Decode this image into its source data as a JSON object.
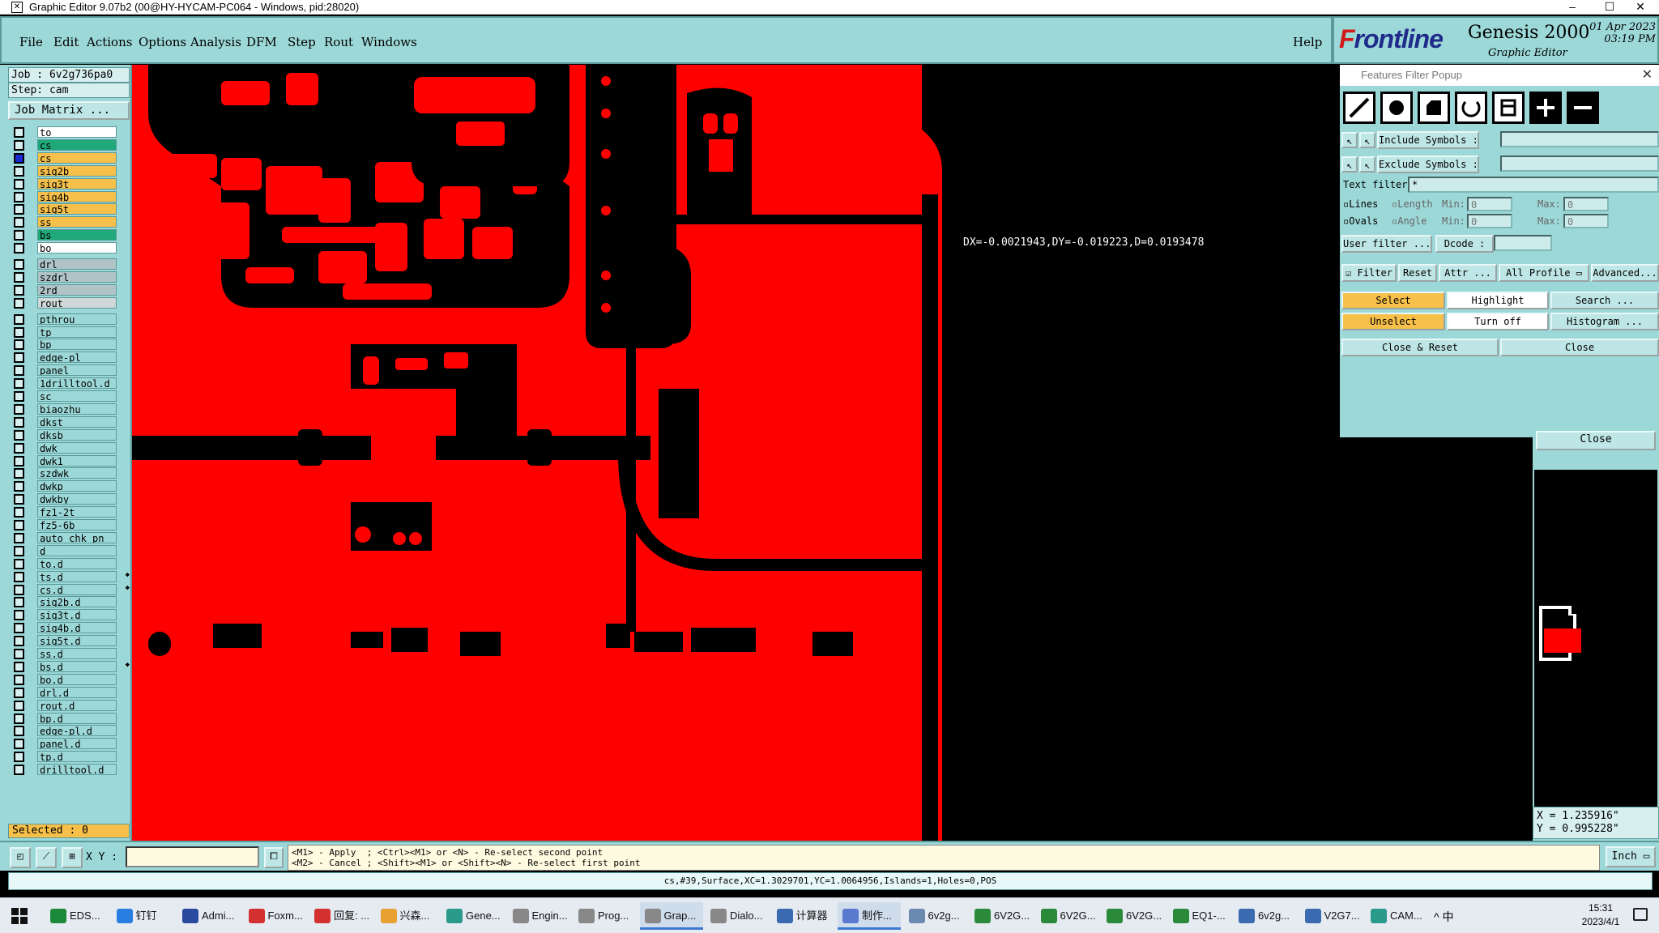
{
  "window": {
    "title": "Graphic Editor 9.07b2 (00@HY-HYCAM-PC064 - Windows, pid:28020)",
    "minimize": "–",
    "maximize": "☐",
    "close": "✕"
  },
  "menu": [
    "File",
    "Edit",
    "Actions",
    "Options",
    "Analysis",
    "DFM",
    "Step",
    "Rout",
    "Windows"
  ],
  "help": "Help",
  "brand": {
    "logo_pre": "F",
    "logo_rest": "rontline",
    "product": "Genesis 2000",
    "sub": "Graphic Editor",
    "date": "01 Apr 2023",
    "time": "03:19 PM"
  },
  "left": {
    "job": "Job  :  6v2g736pa0",
    "step": "Step:  cam",
    "job_matrix": "Job Matrix ...",
    "selected": "Selected : 0"
  },
  "layers": [
    {
      "name": "to",
      "color": "#ffffff"
    },
    {
      "name": "cs",
      "color": "#1fa87a"
    },
    {
      "name": "cs",
      "color": "#f6c04a",
      "selected": true
    },
    {
      "name": "sig2b",
      "color": "#f6c04a"
    },
    {
      "name": "sig3t",
      "color": "#f6c04a"
    },
    {
      "name": "sig4b",
      "color": "#f6c04a"
    },
    {
      "name": "sig5t",
      "color": "#f6c04a"
    },
    {
      "name": "ss",
      "color": "#f6c04a"
    },
    {
      "name": "bs",
      "color": "#1fa87a"
    },
    {
      "name": "bo",
      "color": "#ffffff"
    },
    {
      "name": "drl",
      "color": "#b0c4c8"
    },
    {
      "name": "szdrl",
      "color": "#b0c4c8"
    },
    {
      "name": "2rd",
      "color": "#b0c4c8"
    },
    {
      "name": "rout",
      "color": "#d0d8da"
    },
    {
      "name": "pthrou",
      "color": "#9dd8d8"
    },
    {
      "name": "tp",
      "color": "#9dd8d8"
    },
    {
      "name": "bp",
      "color": "#9dd8d8"
    },
    {
      "name": "edge-pl",
      "color": "#9dd8d8"
    },
    {
      "name": "panel",
      "color": "#9dd8d8"
    },
    {
      "name": "1drilltool.d",
      "color": "#9dd8d8"
    },
    {
      "name": "sc",
      "color": "#9dd8d8"
    },
    {
      "name": "biaozhu",
      "color": "#9dd8d8"
    },
    {
      "name": "dkst",
      "color": "#9dd8d8"
    },
    {
      "name": "dksb",
      "color": "#9dd8d8"
    },
    {
      "name": "dwk",
      "color": "#9dd8d8"
    },
    {
      "name": "dwk1",
      "color": "#9dd8d8"
    },
    {
      "name": "szdwk",
      "color": "#9dd8d8"
    },
    {
      "name": "dwkp",
      "color": "#9dd8d8"
    },
    {
      "name": "dwkby",
      "color": "#9dd8d8"
    },
    {
      "name": "fz1-2t",
      "color": "#9dd8d8"
    },
    {
      "name": "fz5-6b",
      "color": "#9dd8d8"
    },
    {
      "name": "auto_chk_pn",
      "color": "#9dd8d8"
    },
    {
      "name": "d",
      "color": "#9dd8d8"
    },
    {
      "name": "to.d",
      "color": "#9dd8d8"
    },
    {
      "name": "ts.d",
      "color": "#9dd8d8",
      "mark": "◆"
    },
    {
      "name": "cs.d",
      "color": "#9dd8d8",
      "mark": "◆"
    },
    {
      "name": "sig2b.d",
      "color": "#9dd8d8"
    },
    {
      "name": "sig3t.d",
      "color": "#9dd8d8"
    },
    {
      "name": "sig4b.d",
      "color": "#9dd8d8"
    },
    {
      "name": "sig5t.d",
      "color": "#9dd8d8"
    },
    {
      "name": "ss.d",
      "color": "#9dd8d8"
    },
    {
      "name": "bs.d",
      "color": "#9dd8d8",
      "mark": "◆"
    },
    {
      "name": "bo.d",
      "color": "#9dd8d8"
    },
    {
      "name": "drl.d",
      "color": "#9dd8d8"
    },
    {
      "name": "rout.d",
      "color": "#9dd8d8"
    },
    {
      "name": "bp.d",
      "color": "#9dd8d8"
    },
    {
      "name": "edge-pl.d",
      "color": "#9dd8d8"
    },
    {
      "name": "panel.d",
      "color": "#9dd8d8"
    },
    {
      "name": "tp.d",
      "color": "#9dd8d8"
    },
    {
      "name": "drilltool.d",
      "color": "#9dd8d8"
    }
  ],
  "measure": "DX=-0.0021943,DY=-0.019223,D=0.0193478",
  "filter_popup": {
    "title": "Features Filter Popup",
    "include": "Include Symbols :",
    "exclude": "Exclude Symbols :",
    "text_filter": "Text filter",
    "text_filter_value": "*",
    "lines": "Lines",
    "ovals": "Ovals",
    "length": "Length",
    "angle": "Angle",
    "min": "Min:",
    "max": "Max:",
    "zero": "0",
    "user_filter": "User filter ...",
    "dcode": "Dcode :",
    "filter": "Filter",
    "reset": "Reset",
    "attr": "Attr ...",
    "all_profile": "All Profile",
    "advanced": "Advanced...",
    "select": "Select",
    "highlight": "Highlight",
    "search": "Search ...",
    "unselect": "Unselect",
    "turn_off": "Turn off",
    "histogram": "Histogram ...",
    "close_reset": "Close & Reset",
    "close": "Close",
    "close2": "Close"
  },
  "coords": {
    "x": "X  =  1.235916\"",
    "y": "Y  =  0.995228\""
  },
  "status": {
    "xy_label": "X Y :",
    "hint1": "<M1> - Apply  ; <Ctrl><M1> or <N> - Re-select second point",
    "hint2": "<M2> - Cancel ; <Shift><M1> or <Shift><N> - Re-select first point",
    "units": "Inch",
    "info": "cs,#39,Surface,XC=1.3029701,YC=1.0064956,Islands=1,Holes=0,POS"
  },
  "colors": {
    "copper": "#ff0000",
    "panel": "#9dd8d8"
  },
  "taskbar": {
    "items": [
      {
        "label": "EDS...",
        "color": "#1a8a3a"
      },
      {
        "label": "钉钉",
        "color": "#2a7de1"
      },
      {
        "label": "Admi...",
        "color": "#2a4aa0"
      },
      {
        "label": "Foxm...",
        "color": "#d43030"
      },
      {
        "label": "回复: ...",
        "color": "#d43030"
      },
      {
        "label": "兴森...",
        "color": "#e8a030"
      },
      {
        "label": "Gene...",
        "color": "#2a9a8a"
      },
      {
        "label": "Engin...",
        "color": "#888888"
      },
      {
        "label": "Prog...",
        "color": "#888888"
      },
      {
        "label": "Grap...",
        "color": "#888888",
        "active": true
      },
      {
        "label": "Dialo...",
        "color": "#888888"
      },
      {
        "label": "计算器",
        "color": "#3a6ab0"
      },
      {
        "label": "制作...",
        "color": "#5a7ad0",
        "active": true
      },
      {
        "label": "6v2g...",
        "color": "#6a8ab0"
      },
      {
        "label": "6V2G...",
        "color": "#2a8a3a"
      },
      {
        "label": "6V2G...",
        "color": "#2a8a3a"
      },
      {
        "label": "6V2G...",
        "color": "#2a8a3a"
      },
      {
        "label": "EQ1-...",
        "color": "#2a8a3a"
      },
      {
        "label": "6v2g...",
        "color": "#3a6ab0"
      },
      {
        "label": "V2G7...",
        "color": "#3a6ab0"
      },
      {
        "label": "CAM...",
        "color": "#2a9a8a"
      }
    ],
    "tray": "^  中",
    "time": "15:31",
    "date": "2023/4/1"
  }
}
